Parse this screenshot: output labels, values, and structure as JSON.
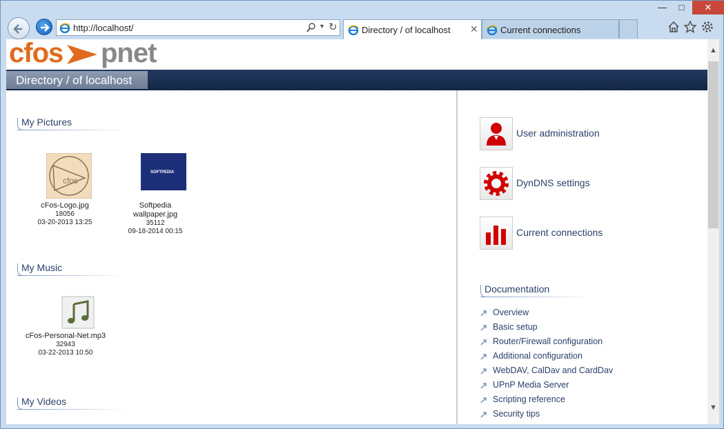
{
  "browser": {
    "address": "http://localhost/",
    "tabs": [
      {
        "label": "Directory / of localhost"
      },
      {
        "label": "Current connections"
      }
    ]
  },
  "page": {
    "title": "Directory / of localhost",
    "logo": {
      "left": "cfos",
      "right": "pnet"
    }
  },
  "pictures": {
    "heading": "My Pictures",
    "files": [
      {
        "name": "cFos-Logo.jpg",
        "size": "18056",
        "date": "03-20-2013 13:25"
      },
      {
        "name": "Softpedia wallpaper.jpg",
        "size": "35112",
        "date": "09-18-2014 00:15",
        "thumb_text": "SOFTPEDIA"
      }
    ]
  },
  "music": {
    "heading": "My Music",
    "files": [
      {
        "name": "cFos-Personal-Net.mp3",
        "size": "32943",
        "date": "03-22-2013 10:50"
      }
    ]
  },
  "videos": {
    "heading": "My Videos"
  },
  "admin": [
    {
      "label": "User administration",
      "icon": "user-icon"
    },
    {
      "label": "DynDNS settings",
      "icon": "gear-icon"
    },
    {
      "label": "Current connections",
      "icon": "bar-chart-icon"
    }
  ],
  "docs": {
    "heading": "Documentation",
    "links": [
      "Overview",
      "Basic setup",
      "Router/Firewall configuration",
      "Additional configuration",
      "WebDAV, CalDav and CardDav",
      "UPnP Media Server",
      "Scripting reference",
      "Security tips"
    ]
  },
  "colors": {
    "accent": "#e06b1e",
    "heading": "#2a3f69",
    "icon_red": "#d10000",
    "titlebar": "#1b2f52"
  }
}
